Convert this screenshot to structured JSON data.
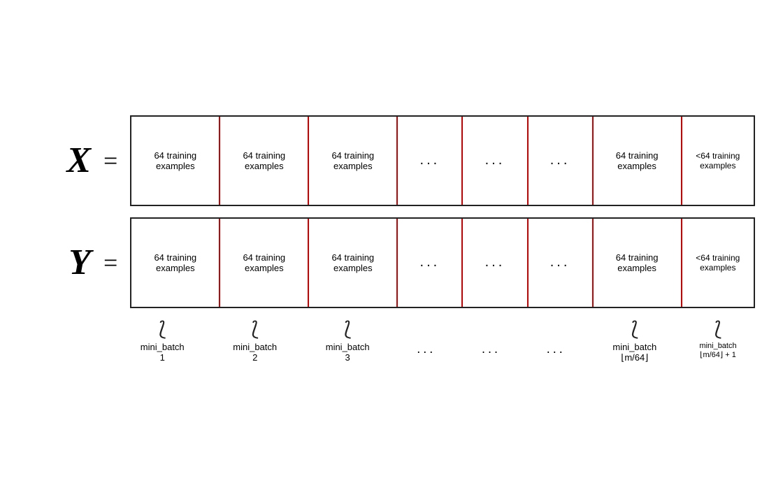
{
  "X_label": "X",
  "Y_label": "Y",
  "equals": "=",
  "cells": {
    "normal": "64 training examples",
    "small": "<64 training examples",
    "dots": "..."
  },
  "braces": {
    "b1_line1": "mini_batch",
    "b1_line2": "1",
    "b2_line1": "mini_batch",
    "b2_line2": "2",
    "b3_line1": "mini_batch",
    "b3_line2": "3",
    "bn_line1": "mini_batch",
    "bn_line2": "⌊m/64⌋",
    "blast_line1": "mini_batch",
    "blast_line2": "⌊m/64⌋ + 1"
  }
}
